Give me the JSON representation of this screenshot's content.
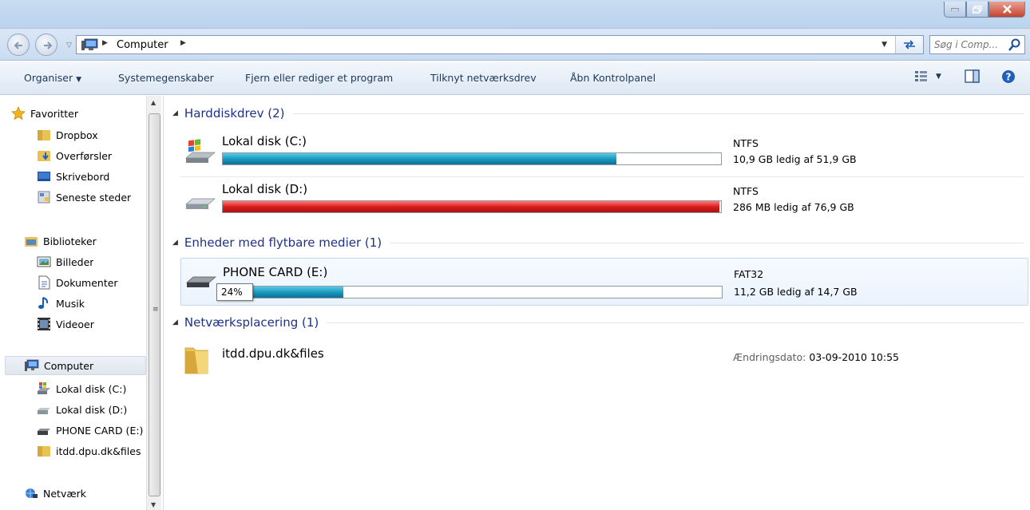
{
  "window": {
    "minimize_icon": "minimize-icon",
    "maximize_icon": "restore-icon",
    "close_icon": "close-icon"
  },
  "address": {
    "location": "Computer",
    "search_placeholder": "Søg i Comp..."
  },
  "toolbar": {
    "organize": "Organiser",
    "system_properties": "Systemegenskaber",
    "uninstall": "Fjern eller rediger et program",
    "map_drive": "Tilknyt netværksdrev",
    "control_panel": "Åbn Kontrolpanel"
  },
  "nav": {
    "favorites": "Favoritter",
    "dropbox": "Dropbox",
    "downloads": "Overførsler",
    "desktop": "Skrivebord",
    "recent": "Seneste steder",
    "libraries": "Biblioteker",
    "pictures": "Billeder",
    "documents": "Dokumenter",
    "music": "Musik",
    "videos": "Videoer",
    "computer": "Computer",
    "disk_c": "Lokal disk (C:)",
    "disk_d": "Lokal disk (D:)",
    "phone_card": "PHONE CARD (E:)",
    "network_folder": "itdd.dpu.dk&files",
    "network": "Netværk"
  },
  "groups": {
    "hard_drives": "Harddiskdrev (2)",
    "removable": "Enheder med flytbare medier (1)",
    "network_locations": "Netværksplacering (1)"
  },
  "drives": [
    {
      "name": "Lokal disk (C:)",
      "fs": "NTFS",
      "free": "10,9 GB ledig af 51,9 GB",
      "used_fraction": 0.79,
      "color": "#1b9bbf"
    },
    {
      "name": "Lokal disk (D:)",
      "fs": "NTFS",
      "free": "286 MB ledig af 76,9 GB",
      "used_fraction": 0.996,
      "color": "#dd1d1d"
    },
    {
      "name": "PHONE CARD (E:)",
      "fs": "FAT32",
      "free": "11,2 GB ledig af 14,7 GB",
      "used_fraction": 0.24,
      "color": "#1b9bbf",
      "tooltip": "24%"
    }
  ],
  "network_item": {
    "name": "itdd.dpu.dk&files",
    "modified_label": "Ændringsdato:",
    "modified_value": "03-09-2010 10:55"
  }
}
